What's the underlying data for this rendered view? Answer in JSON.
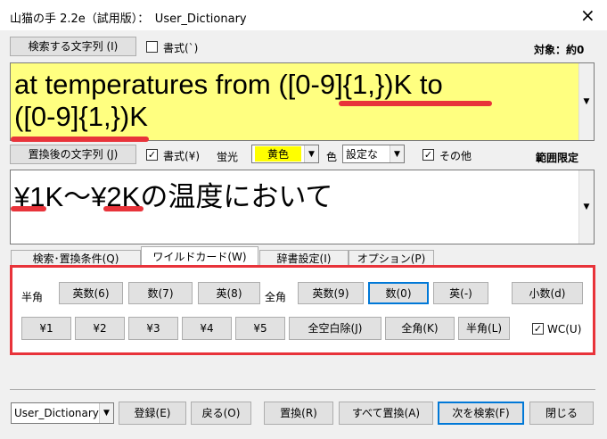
{
  "window": {
    "title": "山猫の手 2.2e（試用版）：　User_Dictionary",
    "close_icon": "×"
  },
  "search": {
    "button_label": "検索する文字列 (I)",
    "format_label": "書式(`)",
    "format_checked": false,
    "target_label": "対象：約0",
    "text": "at temperatures from ([0-9]{1,})K to ([0-9]{1,})K",
    "text_line1": "at temperatures from ([0-9]{1,})K to",
    "text_line2": "([0-9]{1,})K"
  },
  "replace": {
    "button_label": "置換後の文字列 (J)",
    "format_label": "書式(¥)",
    "format_checked": true,
    "highlight_label": "蛍光",
    "highlight_value": "黄色",
    "color_label": "色",
    "color_value": "設定な",
    "other_label": "その他",
    "other_checked": true,
    "range_label": "範囲限定",
    "text": "¥1K〜¥2Kの温度において"
  },
  "tabs": [
    {
      "label": "検索･置換条件(Q)"
    },
    {
      "label": "ワイルドカード(W)"
    },
    {
      "label": "辞書設定(I)"
    },
    {
      "label": "オプション(P)"
    }
  ],
  "wildcard": {
    "half_label": "半角",
    "full_label": "全角",
    "half_buttons": [
      "英数(6)",
      "数(7)",
      "英(8)"
    ],
    "full_buttons": [
      "英数(9)",
      "数(0)",
      "英(-)"
    ],
    "decimal_button": "小数(d)",
    "ref_buttons": [
      "¥1",
      "¥2",
      "¥3",
      "¥4",
      "¥5"
    ],
    "remove_space_button": "全空白除(J)",
    "to_full_button": "全角(K)",
    "to_half_button": "半角(L)",
    "wc_label": "WC(U)",
    "wc_checked": true
  },
  "footer": {
    "dictionary_value": "User_Dictionary",
    "register_button": "登録(E)",
    "back_button": "戻る(O)",
    "replace_button": "置換(R)",
    "replace_all_button": "すべて置換(A)",
    "find_next_button": "次を検索(F)",
    "close_button": "閉じる"
  },
  "colors": {
    "search_bg": "#ffff80",
    "highlight_bg": "#ffff00",
    "annotation_red": "#e8333a"
  }
}
